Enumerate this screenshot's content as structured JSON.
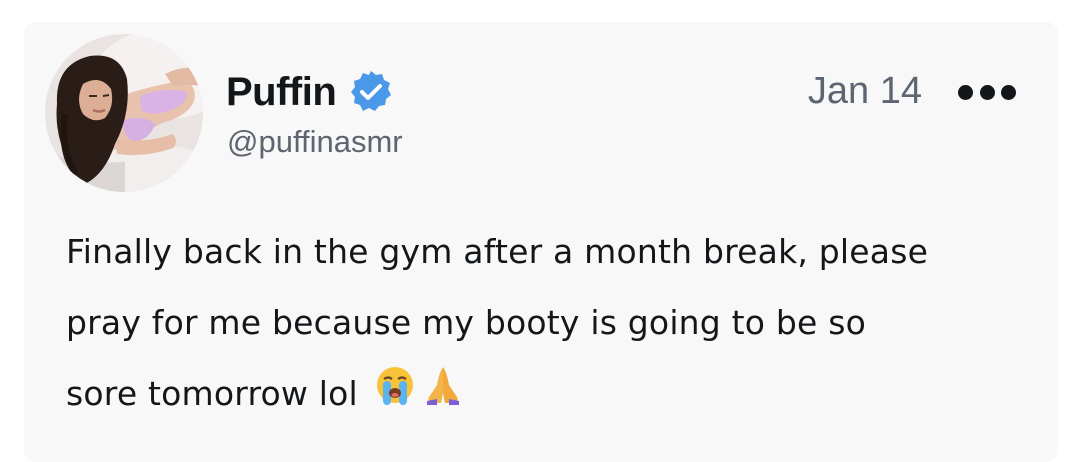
{
  "author": {
    "name": "Puffin",
    "handle": "@puffinasmr",
    "verified": true,
    "avatar": "profile-photo"
  },
  "post": {
    "date": "Jan 14",
    "text_lines": [
      "Finally back in the gym after a month break, please",
      "pray for me because my booty is going to be so",
      "sore tomorrow lol"
    ],
    "emojis": [
      "loudly-crying-face",
      "folded-hands"
    ]
  },
  "icons": {
    "verified": "verified-badge-icon",
    "more": "more-options-icon"
  },
  "colors": {
    "verified_badge": "#4a99e9",
    "text_primary": "#14171a",
    "text_secondary": "#5c6570",
    "card_background": "#f8f8f9"
  }
}
